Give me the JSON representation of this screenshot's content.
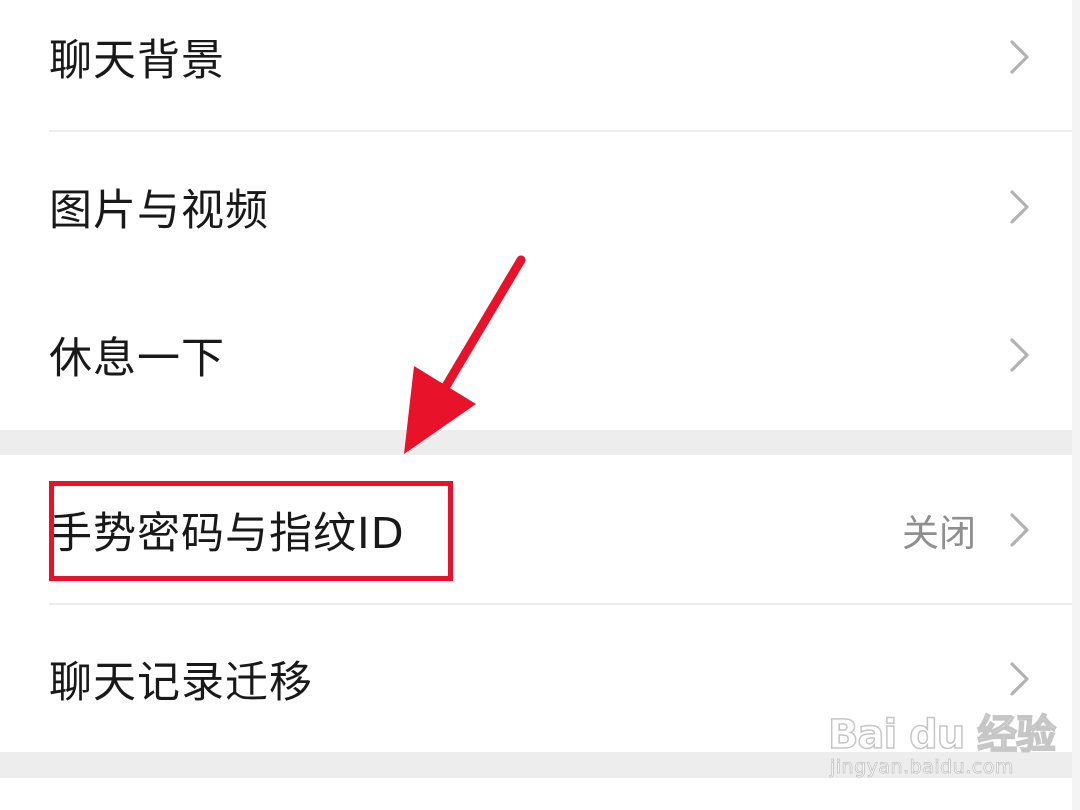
{
  "settings": {
    "items": [
      {
        "label": "聊天背景",
        "value": ""
      },
      {
        "label": "图片与视频",
        "value": ""
      },
      {
        "label": "休息一下",
        "value": ""
      },
      {
        "label": "手势密码与指纹ID",
        "value": "关闭"
      },
      {
        "label": "聊天记录迁移",
        "value": ""
      }
    ]
  },
  "annotation": {
    "highlight_color": "#e8122a",
    "arrow_color": "#e8122a",
    "highlighted_item": "手势密码与指纹ID"
  },
  "watermark": {
    "brand": "Bai du 经验",
    "url": "jingyan.baidu.com"
  },
  "icons": {
    "row_chevron": "chevron-right-icon"
  }
}
